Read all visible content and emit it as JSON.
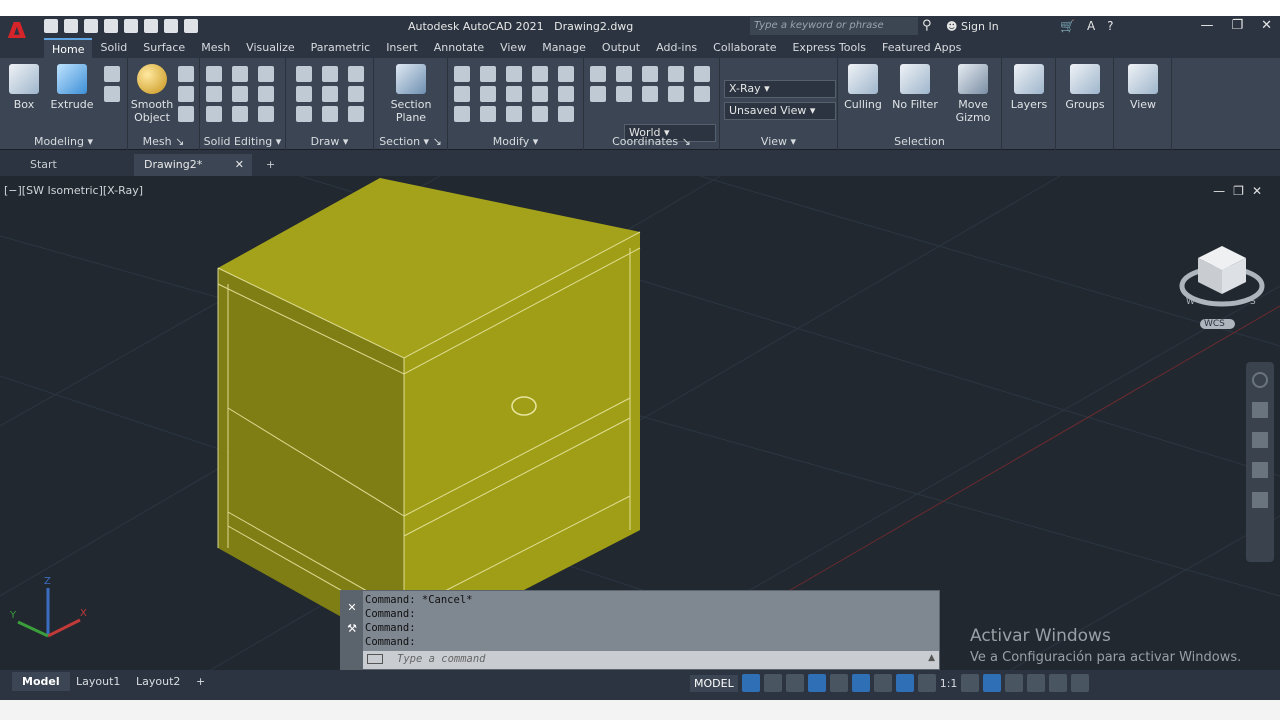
{
  "app": {
    "title": "Autodesk AutoCAD 2021",
    "file": "Drawing2.dwg",
    "search_placeholder": "Type a keyword or phrase",
    "sign_in": "Sign In"
  },
  "ribbon_tabs": [
    "Home",
    "Solid",
    "Surface",
    "Mesh",
    "Visualize",
    "Parametric",
    "Insert",
    "Annotate",
    "View",
    "Manage",
    "Output",
    "Add-ins",
    "Collaborate",
    "Express Tools",
    "Featured Apps"
  ],
  "panels": {
    "modeling": {
      "title": "Modeling",
      "box": "Box",
      "extrude": "Extrude"
    },
    "mesh": {
      "title": "Mesh",
      "smooth": "Smooth Object"
    },
    "solid_editing": {
      "title": "Solid Editing"
    },
    "draw": {
      "title": "Draw"
    },
    "section": {
      "title": "Section",
      "plane": "Section Plane"
    },
    "modify": {
      "title": "Modify"
    },
    "coordinates": {
      "title": "Coordinates",
      "world": "World"
    },
    "view": {
      "title": "View",
      "visual_style": "X-Ray",
      "saved_view": "Unsaved View"
    },
    "selection": {
      "title": "Selection",
      "culling": "Culling",
      "no_filter": "No Filter",
      "move_gizmo": "Move Gizmo"
    },
    "layers": "Layers",
    "groups": "Groups",
    "viewbtn": "View"
  },
  "doc_tabs": {
    "start": "Start",
    "drawing": "Drawing2*"
  },
  "viewport": {
    "label": "[−][SW Isometric][X-Ray]",
    "wcs": "WCS"
  },
  "command": {
    "lines": [
      "Command: *Cancel*",
      "Command:",
      "Command:",
      "Command:"
    ],
    "placeholder": "Type a command"
  },
  "activation": {
    "line1": "Activar Windows",
    "line2": "Ve a Configuración para activar Windows."
  },
  "layout_tabs": [
    "Model",
    "Layout1",
    "Layout2"
  ],
  "status": {
    "model": "MODEL",
    "scale": "1:1"
  }
}
